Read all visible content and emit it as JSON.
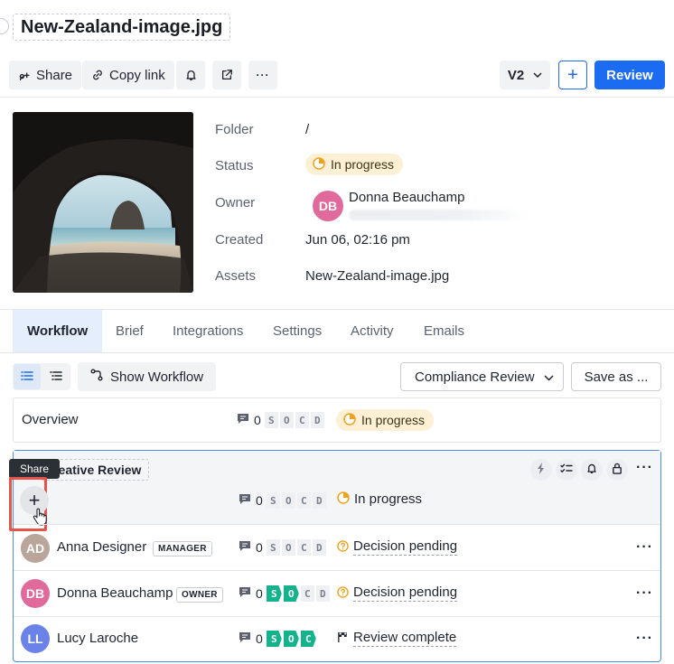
{
  "title": "New-Zealand-image.jpg",
  "toolbar": {
    "share_label": "Share",
    "copy_link_label": "Copy link",
    "version": "V2",
    "add_label": "+",
    "review_label": "Review",
    "more_label": "···"
  },
  "details": {
    "folder_label": "Folder",
    "folder_value": "/",
    "status_label": "Status",
    "status_value": "In progress",
    "owner_label": "Owner",
    "owner_initials": "DB",
    "owner_name": "Donna Beauchamp",
    "created_label": "Created",
    "created_value": "Jun 06, 02:16 pm",
    "assets_label": "Assets",
    "assets_value": "New-Zealand-image.jpg"
  },
  "tabs": [
    {
      "label": "Workflow",
      "active": true
    },
    {
      "label": "Brief"
    },
    {
      "label": "Integrations"
    },
    {
      "label": "Settings"
    },
    {
      "label": "Activity"
    },
    {
      "label": "Emails"
    }
  ],
  "workflow": {
    "show_workflow_label": "Show Workflow",
    "template_select": "Compliance Review",
    "save_as_label": "Save as ...",
    "overview": {
      "label": "Overview",
      "comments": "0",
      "badges": [
        "S",
        "O",
        "C",
        "D"
      ],
      "status": "In progress"
    },
    "stage": {
      "name": "Creative Review",
      "comments": "0",
      "badges": [
        "S",
        "O",
        "C",
        "D"
      ],
      "status": "In progress",
      "tooltip": "Share",
      "add_label": "+"
    },
    "members": [
      {
        "initials": "AD",
        "name": "Anna Designer",
        "role": "MANAGER",
        "comments": "0",
        "badges": [
          "S",
          "O",
          "C",
          "D"
        ],
        "badges_on": 0,
        "status": "Decision pending",
        "avatar_color": "#b9a59a"
      },
      {
        "initials": "DB",
        "name": "Donna Beauchamp",
        "role": "OWNER",
        "comments": "0",
        "badges": [
          "S",
          "O",
          "C",
          "D"
        ],
        "badges_on": 2,
        "status": "Decision pending",
        "avatar_color": "#e06a9c"
      },
      {
        "initials": "LL",
        "name": "Lucy Laroche",
        "role": "",
        "comments": "0",
        "badges": [
          "S",
          "O",
          "C"
        ],
        "badges_on": 3,
        "status": "Review complete",
        "avatar_color": "#6b82e8"
      }
    ],
    "more_label": "···"
  },
  "colors": {
    "accent": "#1b6cf0",
    "progress_bg": "#fdf0d5",
    "progress_icon": "#f0a21a",
    "badge_on": "#14b38b",
    "highlight": "#e5534b"
  }
}
